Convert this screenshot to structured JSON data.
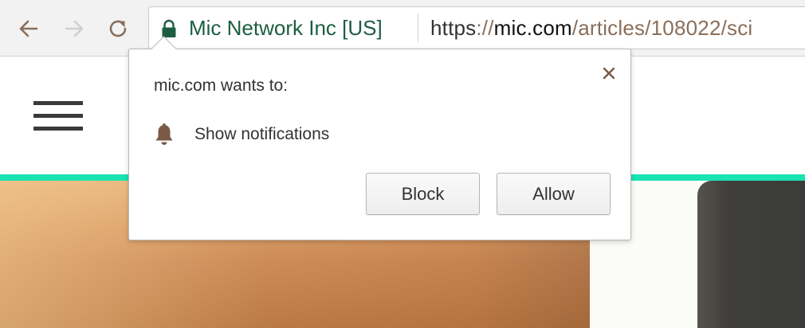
{
  "toolbar": {
    "back_icon": "back-arrow-icon",
    "forward_icon": "forward-arrow-icon",
    "reload_icon": "reload-icon",
    "lock_icon": "lock-icon",
    "site_identity": "Mic Network Inc [US]",
    "url": {
      "scheme": "https",
      "slashes": "://",
      "host": "mic.com",
      "path": "/articles/108022/sci"
    }
  },
  "page": {
    "menu_icon": "hamburger-menu-icon",
    "accent_color": "#19e3b1"
  },
  "permission_bubble": {
    "title": "mic.com wants to:",
    "close_icon": "close-icon",
    "permission_icon": "bell-icon",
    "permission_label": "Show notifications",
    "block_label": "Block",
    "allow_label": "Allow"
  },
  "colors": {
    "site_identity": "#1d5e43",
    "url_path": "#8a6e5a",
    "icon_brown": "#7a5a46"
  }
}
